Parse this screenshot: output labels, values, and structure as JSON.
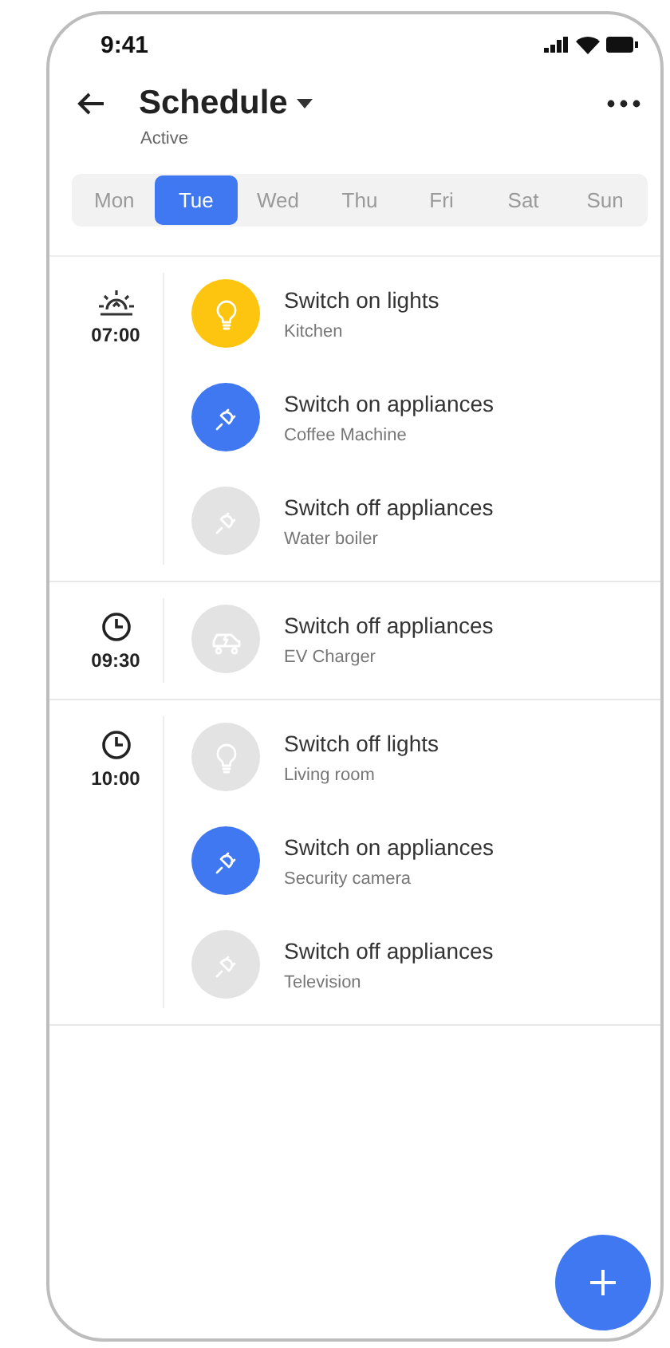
{
  "status_bar": {
    "time": "9:41"
  },
  "header": {
    "title": "Schedule",
    "subtitle": "Active"
  },
  "days": [
    {
      "label": "Mon",
      "selected": false
    },
    {
      "label": "Tue",
      "selected": true
    },
    {
      "label": "Wed",
      "selected": false
    },
    {
      "label": "Thu",
      "selected": false
    },
    {
      "label": "Fri",
      "selected": false
    },
    {
      "label": "Sat",
      "selected": false
    },
    {
      "label": "Sun",
      "selected": false
    }
  ],
  "groups": [
    {
      "kind": "sunrise",
      "time": "07:00",
      "actions": [
        {
          "kind": "light",
          "on": true,
          "title": "Switch on lights",
          "device": "Kitchen"
        },
        {
          "kind": "plug",
          "on": true,
          "title": "Switch on appliances",
          "device": "Coffee Machine"
        },
        {
          "kind": "plug",
          "on": false,
          "title": "Switch off appliances",
          "device": "Water boiler"
        }
      ]
    },
    {
      "kind": "clock",
      "time": "09:30",
      "actions": [
        {
          "kind": "car",
          "on": false,
          "title": "Switch off appliances",
          "device": "EV Charger"
        }
      ]
    },
    {
      "kind": "clock",
      "time": "10:00",
      "actions": [
        {
          "kind": "light",
          "on": false,
          "title": "Switch off lights",
          "device": "Living room"
        },
        {
          "kind": "plug",
          "on": true,
          "title": "Switch on appliances",
          "device": "Security camera"
        },
        {
          "kind": "plug",
          "on": false,
          "title": "Switch off appliances",
          "device": "Television"
        }
      ]
    }
  ]
}
